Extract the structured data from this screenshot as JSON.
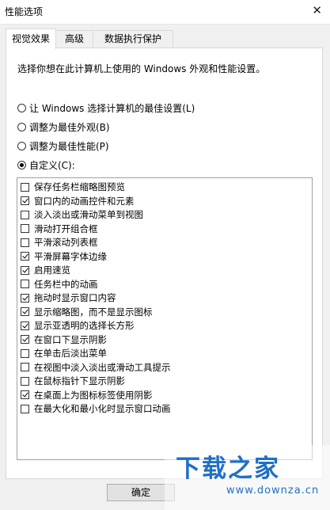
{
  "window": {
    "title": "性能选项",
    "close_icon": "close-icon"
  },
  "tabs": [
    {
      "label": "视觉效果",
      "active": true
    },
    {
      "label": "高级",
      "active": false
    },
    {
      "label": "数据执行保护",
      "active": false
    }
  ],
  "description": "选择你想在此计算机上使用的 Windows 外观和性能设置。",
  "radios": [
    {
      "label": "让 Windows 选择计算机的最佳设置(L)",
      "checked": false
    },
    {
      "label": "调整为最佳外观(B)",
      "checked": false
    },
    {
      "label": "调整为最佳性能(P)",
      "checked": false
    },
    {
      "label": "自定义(C):",
      "checked": true
    }
  ],
  "options": [
    {
      "label": "保存任务栏缩略图预览",
      "checked": false
    },
    {
      "label": "窗口内的动画控件和元素",
      "checked": true
    },
    {
      "label": "淡入淡出或滑动菜单到视图",
      "checked": false
    },
    {
      "label": "滑动打开组合框",
      "checked": false
    },
    {
      "label": "平滑滚动列表框",
      "checked": false
    },
    {
      "label": "平滑屏幕字体边缘",
      "checked": true
    },
    {
      "label": "启用速览",
      "checked": true
    },
    {
      "label": "任务栏中的动画",
      "checked": false
    },
    {
      "label": "拖动时显示窗口内容",
      "checked": true
    },
    {
      "label": "显示缩略图，而不是显示图标",
      "checked": true
    },
    {
      "label": "显示亚透明的选择长方形",
      "checked": true
    },
    {
      "label": "在窗口下显示阴影",
      "checked": true
    },
    {
      "label": "在单击后淡出菜单",
      "checked": false
    },
    {
      "label": "在视图中淡入淡出或滑动工具提示",
      "checked": false
    },
    {
      "label": "在鼠标指针下显示阴影",
      "checked": false
    },
    {
      "label": "在桌面上为图标标签使用阴影",
      "checked": true
    },
    {
      "label": "在最大化和最小化时显示窗口动画",
      "checked": false
    }
  ],
  "buttons": {
    "ok": "确定"
  },
  "watermark": {
    "logo": "下载之家",
    "url": "www.downza.cn"
  }
}
